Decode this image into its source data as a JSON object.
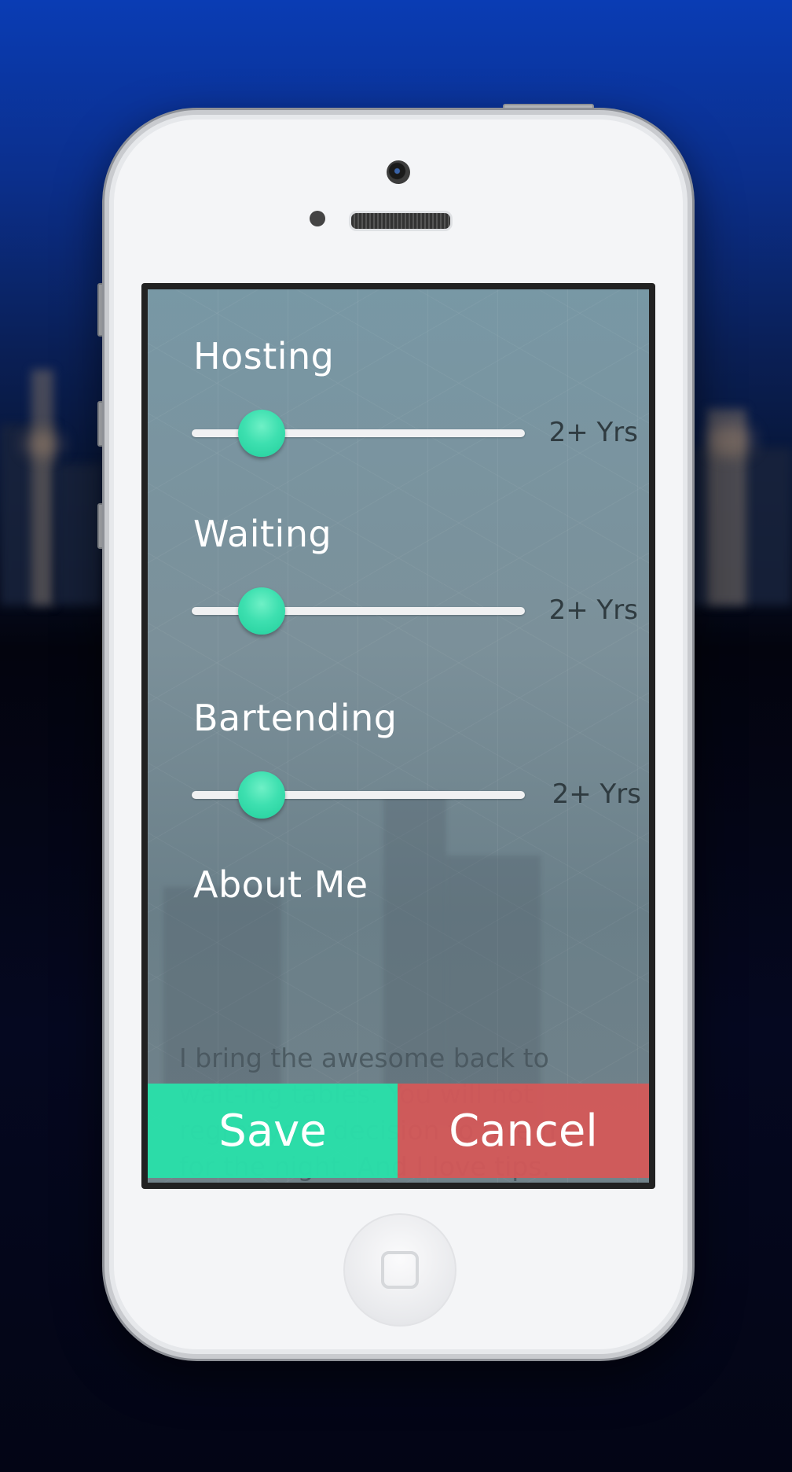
{
  "colors": {
    "accent_green": "#2ae0aa",
    "cancel_red": "#d45858",
    "label_white": "#ffffff",
    "value_dark": "#2f3b40"
  },
  "experience": {
    "hosting": {
      "label": "Hosting",
      "value_text": "2+ Yrs",
      "slider_level": 0.14
    },
    "waiting": {
      "label": "Waiting",
      "value_text": "2+ Yrs",
      "slider_level": 0.14
    },
    "bartending": {
      "label": "Bartending",
      "value_text": "2+ Yrs",
      "slider_level": 0.14
    }
  },
  "about": {
    "label": "About Me",
    "text": "I bring the awesome back to wait-ing tables. You will not regret your decision to hire me for the night. And I love tips."
  },
  "actions": {
    "save_label": "Save",
    "cancel_label": "Cancel"
  }
}
